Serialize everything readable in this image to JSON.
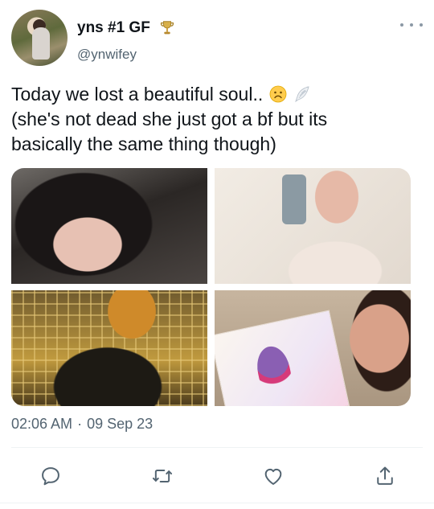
{
  "author": {
    "display_name": "yns #1 GF",
    "handle": "@ynwifey",
    "badge_icon": "trophy-icon",
    "avatar_icon": "avatar"
  },
  "tweet": {
    "line1": "Today we lost a beautiful soul..",
    "line2": "(she's not dead she just got a bf but its",
    "line3": "basically the same thing though)",
    "emojis": [
      "slightly-frowning-face-icon",
      "wing-icon"
    ]
  },
  "media": {
    "count": 4
  },
  "meta": {
    "time": "02:06 AM",
    "separator": "·",
    "date": "09 Sep 23"
  },
  "actions": {
    "icons": [
      "reply-icon",
      "retweet-icon",
      "like-icon",
      "share-icon"
    ]
  },
  "colors": {
    "text": "#0f1419",
    "secondary": "#536471",
    "divider": "#eff3f4",
    "icon": "#536471",
    "trophy": "#c9a43a"
  }
}
